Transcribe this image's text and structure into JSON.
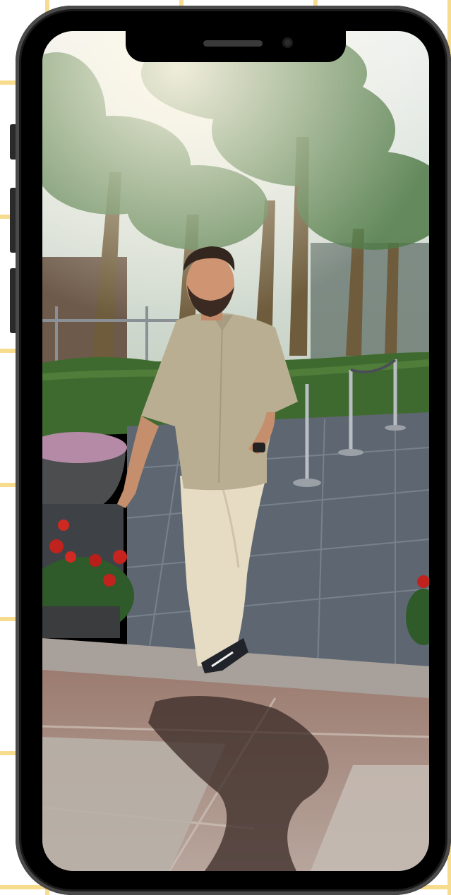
{
  "screen": {
    "description": "",
    "colors": {
      "grid_line": "#f7dc8e",
      "frame": "#000000",
      "sky": "#e9eef0",
      "foliage": "#3f6a2f",
      "shirt": "#b9ae92",
      "pants": "#e6dcc4",
      "paving": "#5e6771",
      "floor": "#8a6a60"
    }
  }
}
